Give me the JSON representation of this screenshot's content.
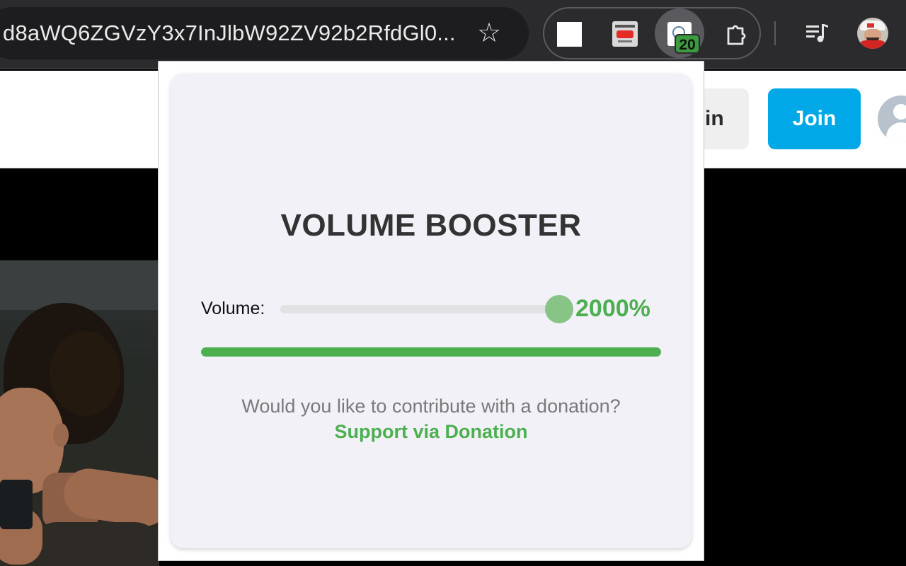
{
  "browser": {
    "url": "d8aWQ6ZGVzY3x7InJlbW92ZV92b2RfdGl0...",
    "extension_badge": "20"
  },
  "page": {
    "signin_label": "in",
    "join_label": "Join"
  },
  "popup": {
    "title": "VOLUME BOOSTER",
    "volume_label": "Volume:",
    "volume_value": "2000%",
    "volume_slider_fraction": 1.0,
    "level_fraction": 1.0,
    "donation_prompt": "Would you like to contribute with a donation?",
    "donation_link": "Support via Donation",
    "accent_color": "#4caf50"
  }
}
